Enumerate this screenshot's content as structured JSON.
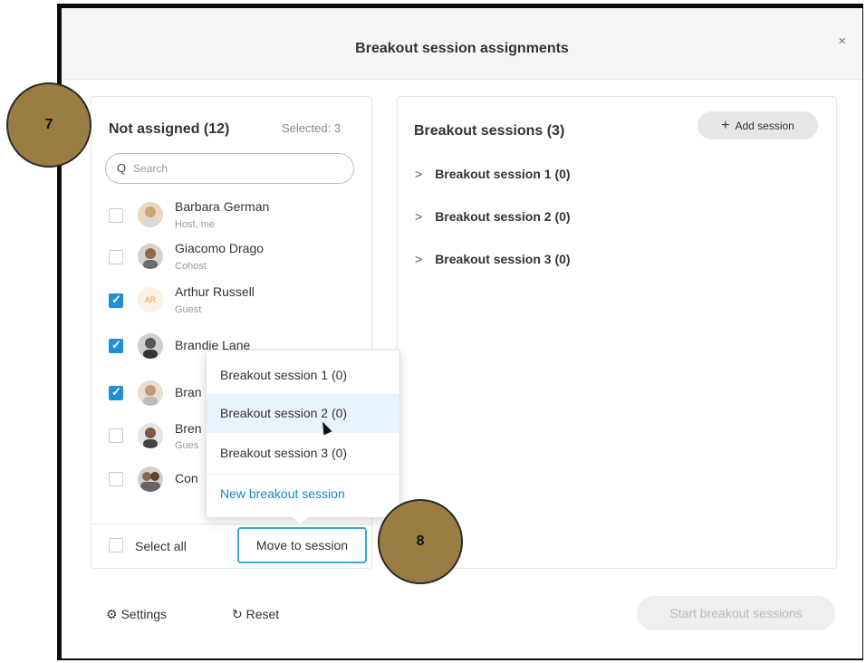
{
  "dialog": {
    "title": "Breakout session assignments",
    "close_label": "×"
  },
  "left": {
    "heading": "Not assigned (12)",
    "selected": "Selected: 3",
    "search": {
      "icon": "Q",
      "placeholder": "Search"
    },
    "people": [
      {
        "name": "Barbara German",
        "role": "Host, me",
        "checked": false
      },
      {
        "name": "Giacomo Drago",
        "role": "Cohost",
        "checked": false
      },
      {
        "name": "Arthur Russell",
        "role": "Guest",
        "checked": true,
        "initials": "AR"
      },
      {
        "name": "Brandie Lane",
        "role": "",
        "checked": true
      },
      {
        "name": "Bran",
        "role": "",
        "checked": true
      },
      {
        "name": "Bren",
        "role": "Gues",
        "checked": false
      },
      {
        "name": "Con",
        "role": "",
        "checked": false
      }
    ],
    "select_all": "Select all",
    "move_button": "Move to session"
  },
  "right": {
    "heading": "Breakout sessions (3)",
    "add_session": "Add session",
    "add_icon": "+",
    "chevron": ">",
    "sessions": [
      "Breakout session 1 (0)",
      "Breakout session 2 (0)",
      "Breakout session 3 (0)"
    ]
  },
  "popup": {
    "items": [
      "Breakout session 1 (0)",
      "Breakout session 2 (0)",
      "Breakout session 3 (0)"
    ],
    "highlighted_index": 1,
    "new_session": "New breakout session"
  },
  "footer": {
    "settings": "Settings",
    "settings_icon": "⚙",
    "reset": "Reset",
    "reset_icon": "↻",
    "start": "Start breakout sessions"
  },
  "badges": [
    "7",
    "8"
  ],
  "colors": {
    "accent": "#1f8fd8",
    "badge": "#9a7d42",
    "link": "#1a86c9"
  }
}
